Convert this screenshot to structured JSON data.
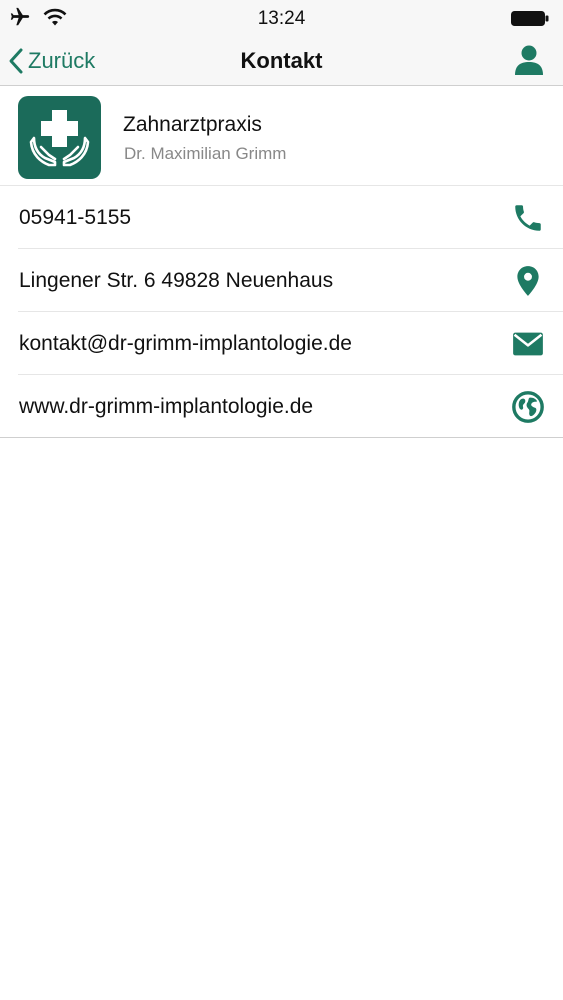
{
  "status": {
    "time": "13:24",
    "left_icons": [
      "airplane-icon",
      "wifi-icon"
    ],
    "right_icons": [
      "battery-icon"
    ]
  },
  "nav": {
    "back_label": "Zurück",
    "title": "Kontakt",
    "right_icon": "person-icon"
  },
  "contact": {
    "name": "Zahnarztpraxis",
    "doctor": "Dr. Maximilian Grimm",
    "logo_icon": "medical-hands-icon",
    "phone": "05941-5155",
    "address": "Lingener Str. 6 49828 Neuenhaus",
    "email": "kontakt@dr-grimm-implantologie.de",
    "website": "www.dr-grimm-implantologie.de"
  },
  "row_icons": [
    "phone-icon",
    "location-pin-icon",
    "mail-icon",
    "globe-icon"
  ],
  "colors": {
    "accent": "#1e7a63",
    "logo_bg": "#1b6b5a",
    "bar_bg": "#f7f7f7",
    "separator": "#e6e6e6",
    "secondary_text": "#888888"
  }
}
